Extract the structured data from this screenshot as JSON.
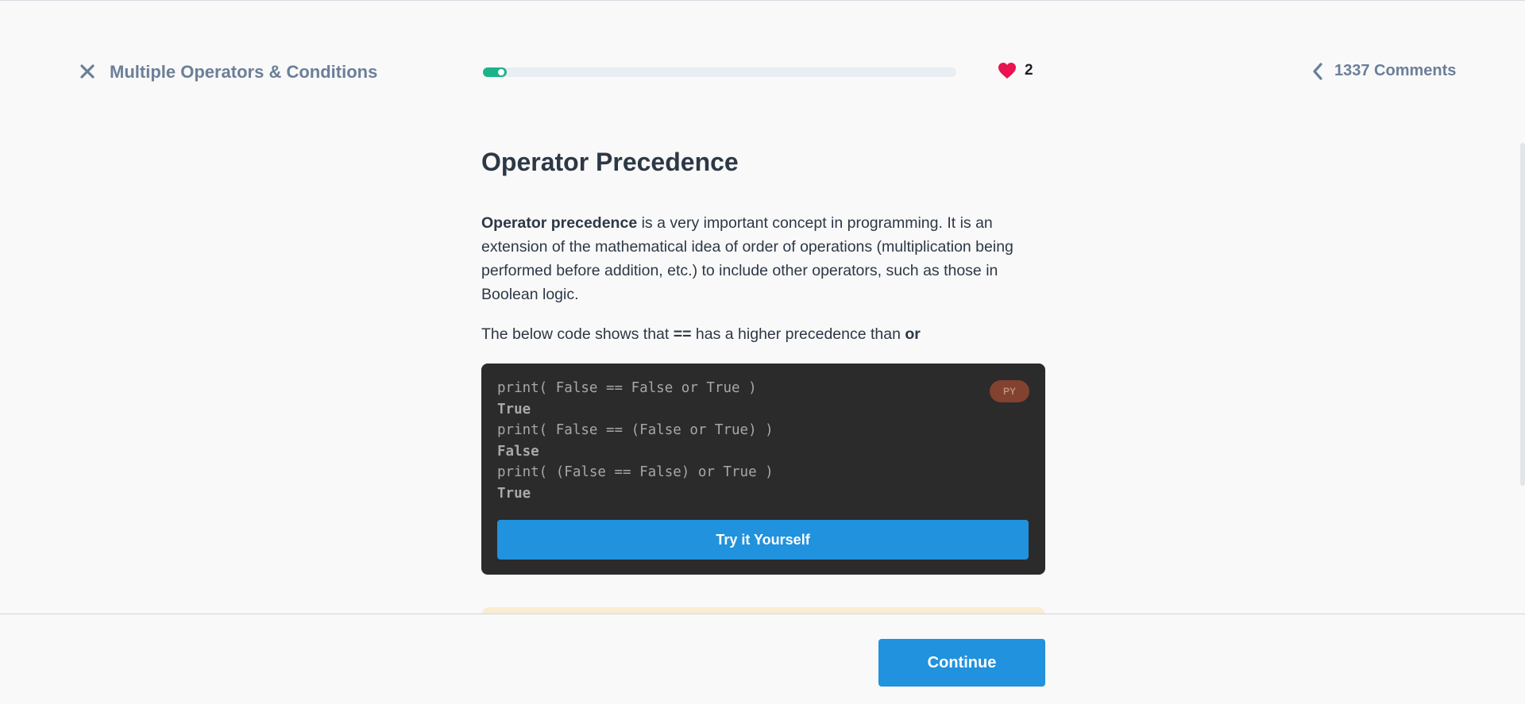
{
  "header": {
    "lesson_title": "Multiple Operators & Conditions",
    "progress_percent": 5,
    "likes_count": "2",
    "comments_label": "1337 Comments"
  },
  "content": {
    "heading": "Operator Precedence",
    "para1_bold": "Operator precedence",
    "para1_rest": " is a very important concept in programming. It is an extension of the mathematical idea of order of operations (multiplication being performed before addition, etc.) to include other operators, such as those in Boolean logic.",
    "para2_start": "The below code shows that ",
    "para2_op1": "==",
    "para2_mid": " has a higher precedence than ",
    "para2_op2": "or"
  },
  "code": {
    "lines": [
      {
        "text": "print( False == False or True )",
        "type": "code"
      },
      {
        "text": "True",
        "type": "output"
      },
      {
        "text": "print( False == (False or True) )",
        "type": "code"
      },
      {
        "text": "False",
        "type": "output"
      },
      {
        "text": "print( (False == False) or True )",
        "type": "code"
      },
      {
        "text": "True",
        "type": "output"
      }
    ],
    "language_badge": "PY",
    "try_button_label": "Try it Yourself"
  },
  "footer": {
    "continue_label": "Continue"
  },
  "colors": {
    "accent_blue": "#2192dd",
    "progress_green": "#1db38a",
    "heart_red": "#e8134f",
    "code_bg": "#2b2b2b"
  }
}
